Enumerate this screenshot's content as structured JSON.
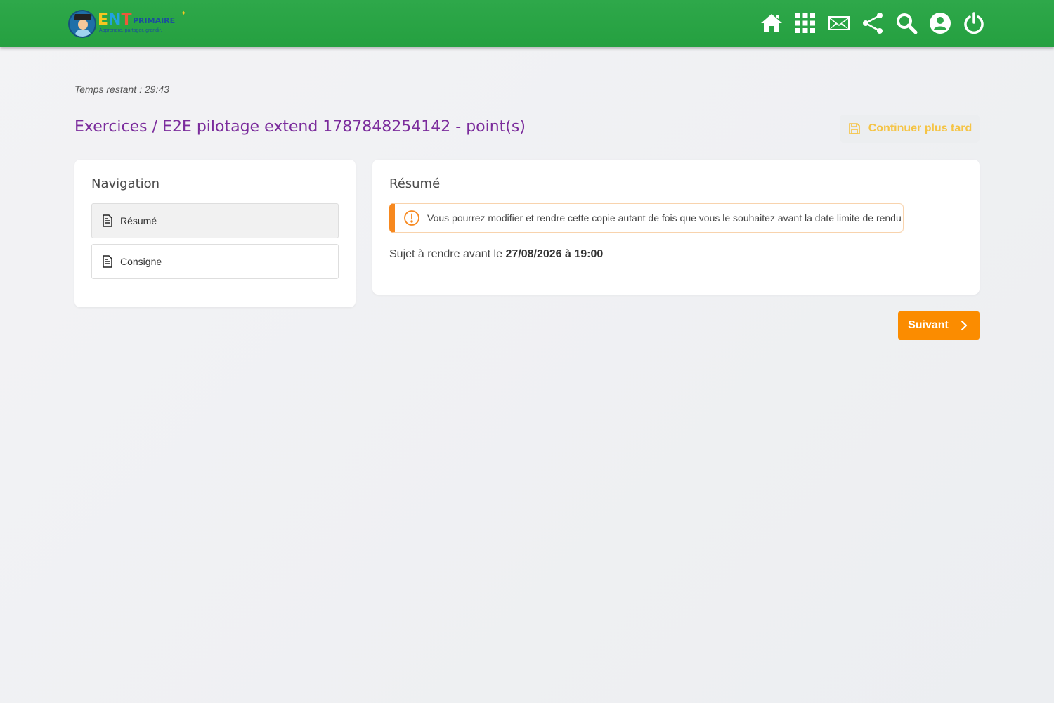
{
  "header": {
    "logo": {
      "name": "ENT",
      "name_suffix": "PRIMAIRE",
      "tagline": "Apprendre, partager, grandir."
    },
    "icons": [
      "home-icon",
      "apps-grid-icon",
      "mail-icon",
      "share-icon",
      "search-icon",
      "account-icon",
      "power-icon"
    ],
    "bar_color": "#2ea84a"
  },
  "timer": {
    "text": "Temps restant : 29:43"
  },
  "page": {
    "title": "Exercices / E2E pilotage extend 1787848254142 -  point(s)",
    "title_color": "#7b2c9c"
  },
  "continue_later_button": {
    "label": "Continuer plus tard",
    "icon": "save-icon",
    "color": "#f5c445"
  },
  "navigation": {
    "title": "Navigation",
    "items": [
      {
        "label": "Résumé",
        "icon": "document-icon",
        "active": true
      },
      {
        "label": "Consigne",
        "icon": "document-icon",
        "active": false
      }
    ]
  },
  "summary": {
    "title": "Résumé",
    "alert_text": "Vous pourrez modifier et rendre cette copie autant de fois que vous le souhaitez avant la date limite de rendu",
    "alert_color": "#f7881e",
    "deadline_prefix": "Sujet à rendre avant le",
    "deadline_value": "27/08/2026 à 19:00"
  },
  "next_button": {
    "label": "Suivant",
    "color": "#fb8c00"
  }
}
